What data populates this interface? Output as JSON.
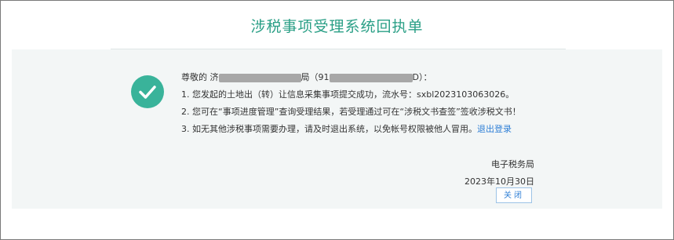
{
  "title": "涉税事项受理系统回执单",
  "greeting": {
    "prefix": "尊敬的",
    "name_visible": "济",
    "name_tail": "局",
    "code_prefix": "（91",
    "code_tail": "D）："
  },
  "lines": [
    "1. 您发起的土地出（转）让信息采集事项提交成功，流水号：sxbl2023103063026。",
    "2. 您可在“事项进度管理”查询受理结果，若受理通过可在“涉税文书查签”签收涉税文书！",
    "3. 如无其他涉税事项需要办理，请及时退出系统，以免帐号权限被他人冒用。"
  ],
  "logout_link": "退出登录",
  "signature": {
    "org": "电子税务局",
    "date": "2023年10月30日"
  },
  "close_button": "关闭",
  "colors": {
    "accent": "#2a9f86",
    "check": "#39b39a",
    "link": "#2f7fd6"
  },
  "icons": {
    "status": "check-circle-icon"
  }
}
